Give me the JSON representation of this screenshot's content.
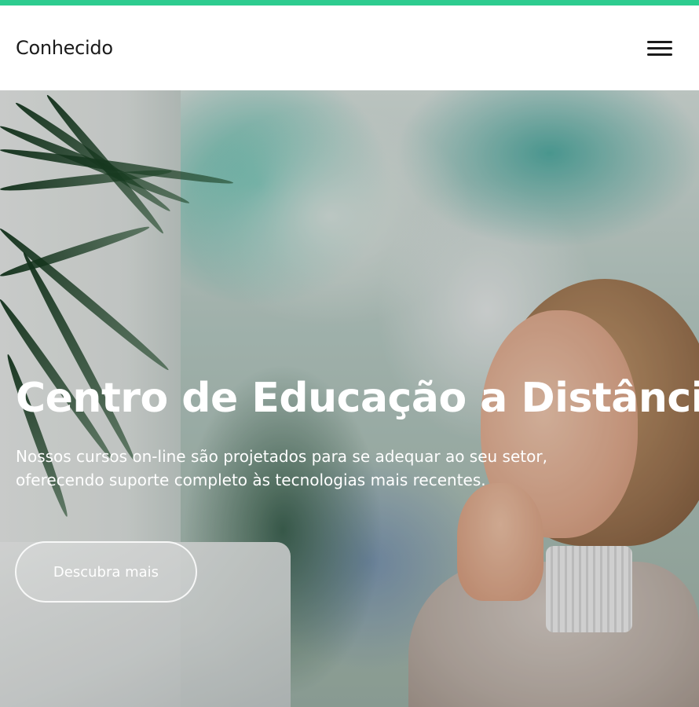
{
  "colors": {
    "accent_stripe": "#2ecc8f",
    "nav_background": "#ffffff",
    "nav_text": "#1b1b1b",
    "hero_text": "#ffffff"
  },
  "navbar": {
    "brand": "Conhecido",
    "menu_icon": "hamburger-menu-icon"
  },
  "hero": {
    "title": "Centro de Educação a Distância",
    "subtitle": "Nossos cursos on-line são projetados para se adequar ao seu setor, oferecendo suporte completo às tecnologias mais recentes.",
    "cta_label": "Descubra mais"
  }
}
